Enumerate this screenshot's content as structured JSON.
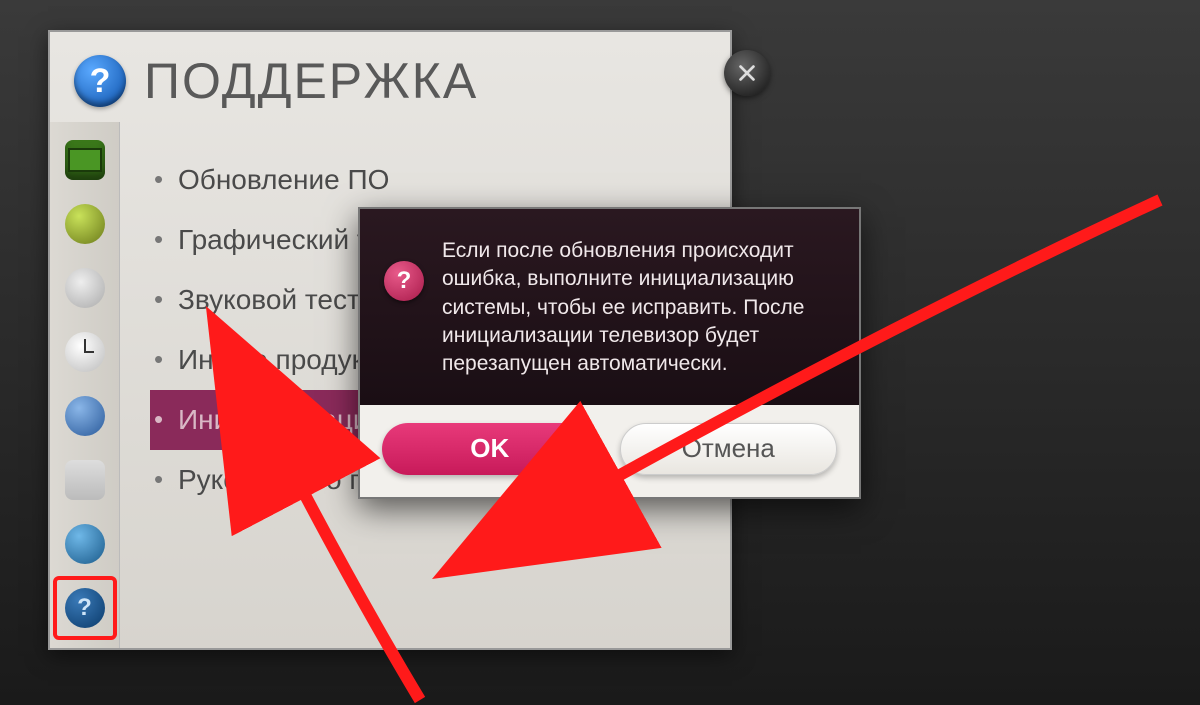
{
  "header": {
    "title": "ПОДДЕРЖКА"
  },
  "menu": {
    "items": [
      "Обновление ПО",
      "Графический тест",
      "Звуковой тест",
      "Инф. о продукте/услуге",
      "Инициализация приложения",
      "Руководство пользователя"
    ],
    "selected_index": 4
  },
  "dialog": {
    "message": "Если после обновления происходит ошибка, выполните инициализацию системы, чтобы ее исправить. После инициализации телевизор будет перезапущен автоматически.",
    "ok": "OK",
    "cancel": "Отмена"
  },
  "colors": {
    "accent": "#d81b60",
    "annotation": "#ff1a1a"
  }
}
